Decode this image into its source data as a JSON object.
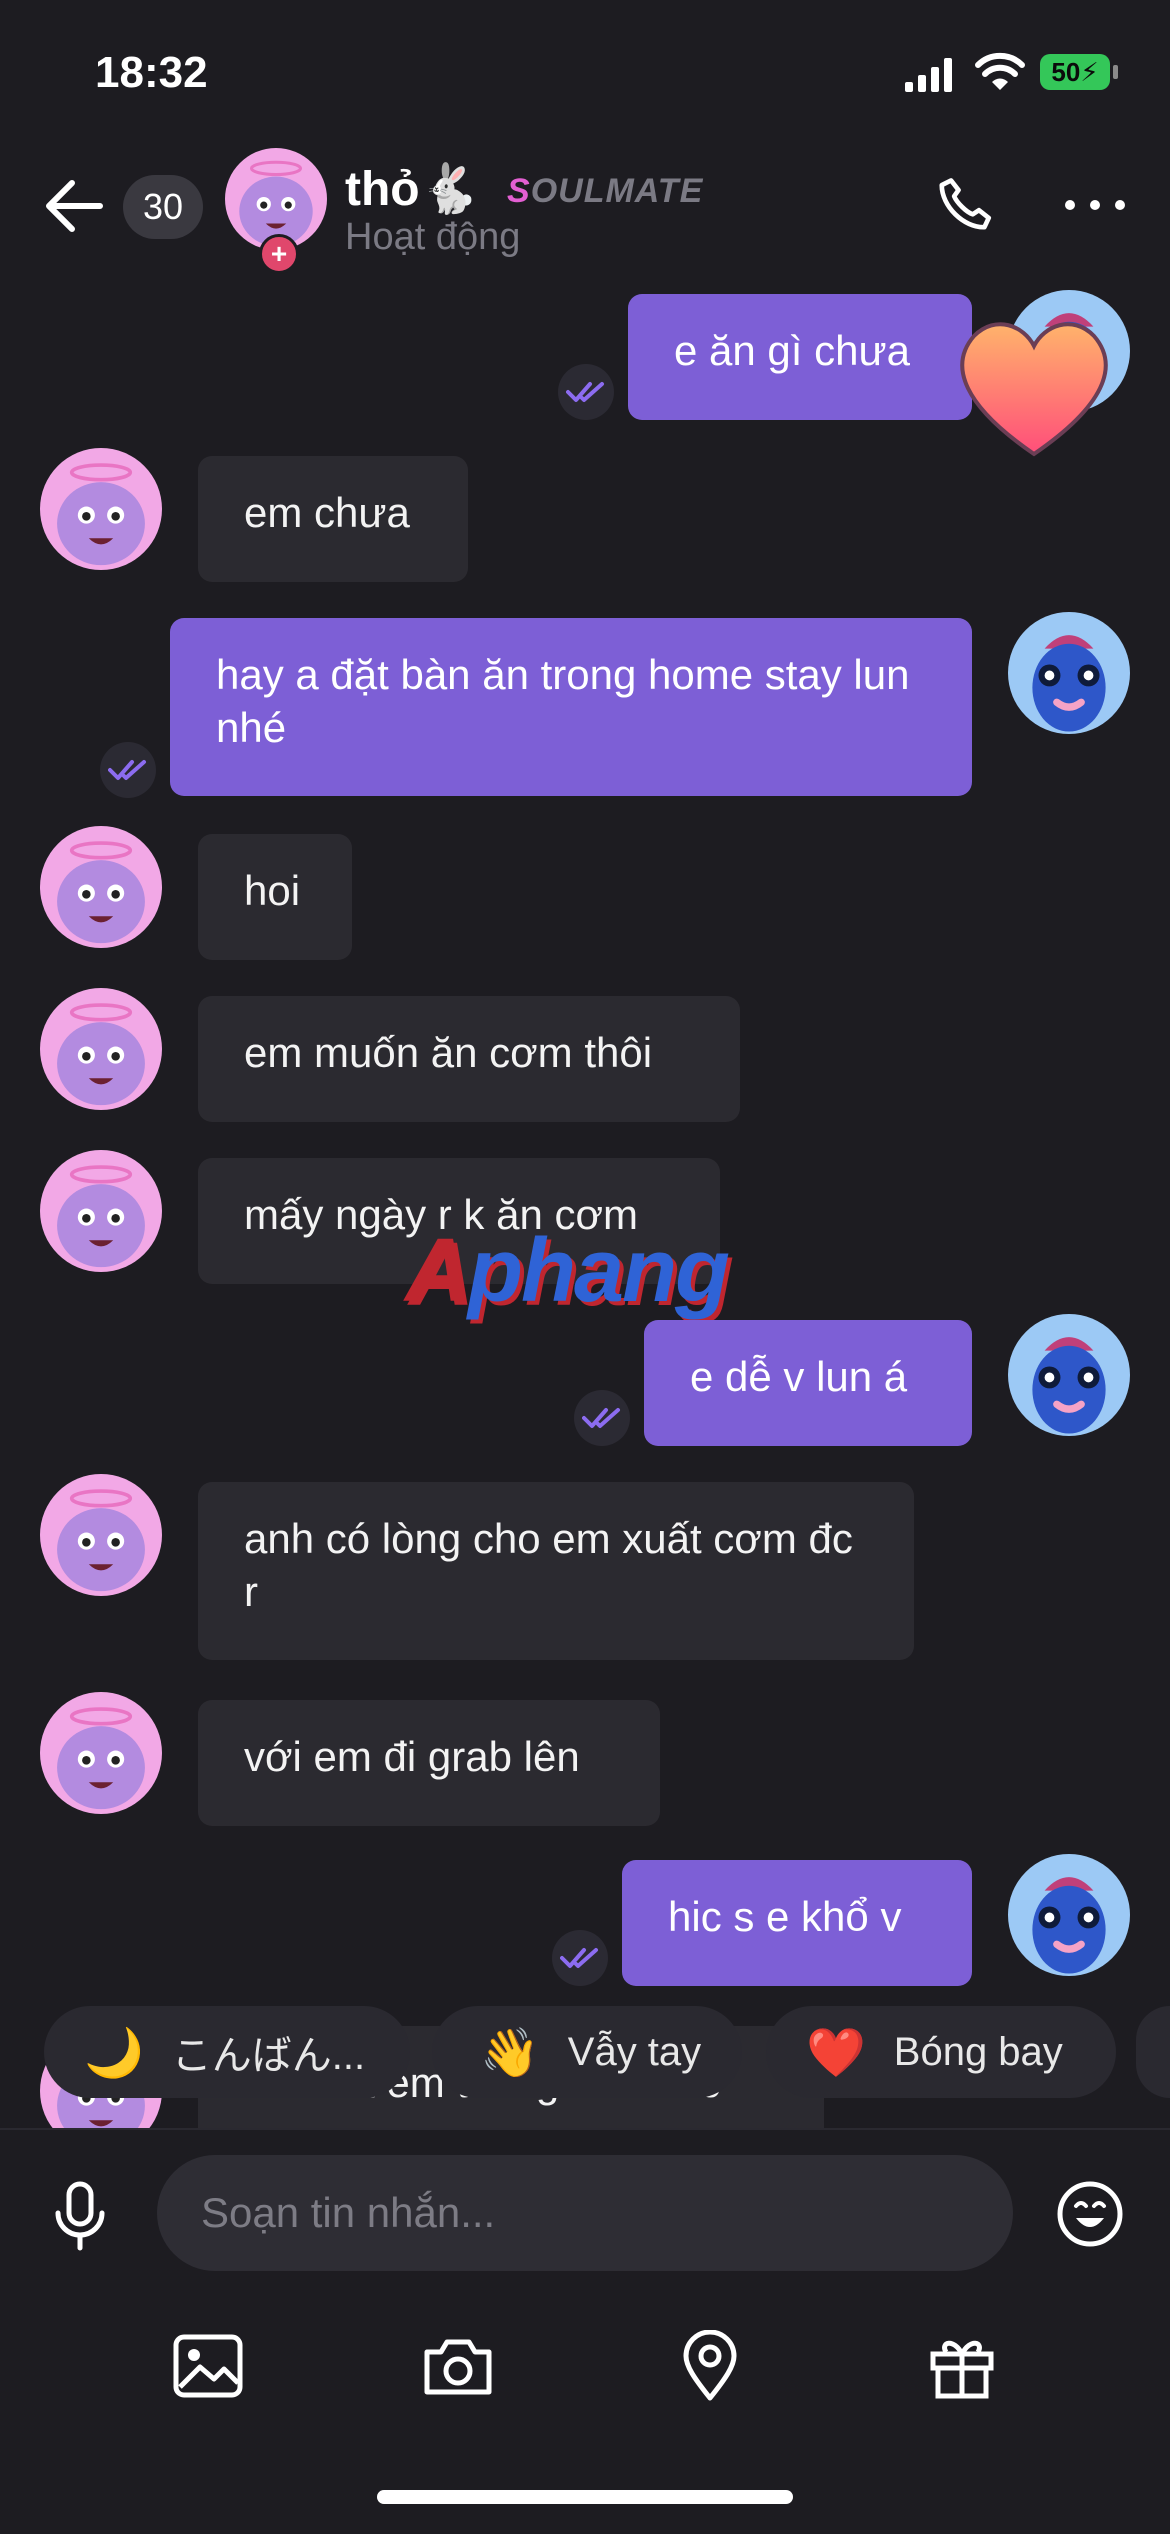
{
  "status_bar": {
    "time": "18:32",
    "battery": "50"
  },
  "header": {
    "unread_count": "30",
    "contact_name": "thỏ🐇",
    "soulmate_s": "S",
    "soulmate_rest": "OULMATE",
    "status": "Hoạt động"
  },
  "messages": [
    {
      "dir": "out",
      "text": "e ăn gì chưa"
    },
    {
      "dir": "in",
      "text": "em chưa"
    },
    {
      "dir": "out",
      "text": "hay a đặt bàn ăn trong home stay lun nhé"
    },
    {
      "dir": "in",
      "text": "hoi"
    },
    {
      "dir": "in",
      "text": "em muốn ăn cơm thôi"
    },
    {
      "dir": "in",
      "text": "mấy ngày r k ăn cơm"
    },
    {
      "dir": "out",
      "text": "e dễ v lun á"
    },
    {
      "dir": "in",
      "text": "anh có lòng cho em xuất cơm đc r"
    },
    {
      "dir": "in",
      "text": "với em đi grab lên"
    },
    {
      "dir": "out",
      "text": "hic s e khổ v"
    },
    {
      "dir": "in",
      "text": "anh trả em tiền grab là đc"
    }
  ],
  "watermark": {
    "r": "A",
    "rest": "phang"
  },
  "quick_replies": [
    {
      "emoji": "🌙",
      "label": "こんばん..."
    },
    {
      "emoji": "👋",
      "label": "Vẫy tay"
    },
    {
      "emoji": "❤️",
      "label": "Bóng bay"
    }
  ],
  "composer": {
    "placeholder": "Soạn tin nhắn..."
  },
  "colors": {
    "accent": "#7d5fd6",
    "incoming": "#2b2a30",
    "background": "#1d1c21"
  },
  "icons": [
    "back-arrow-icon",
    "phone-icon",
    "more-icon",
    "mic-icon",
    "emoji-icon",
    "image-icon",
    "camera-icon",
    "location-icon",
    "gift-icon",
    "seen-check-icon",
    "heart-reaction-icon"
  ]
}
